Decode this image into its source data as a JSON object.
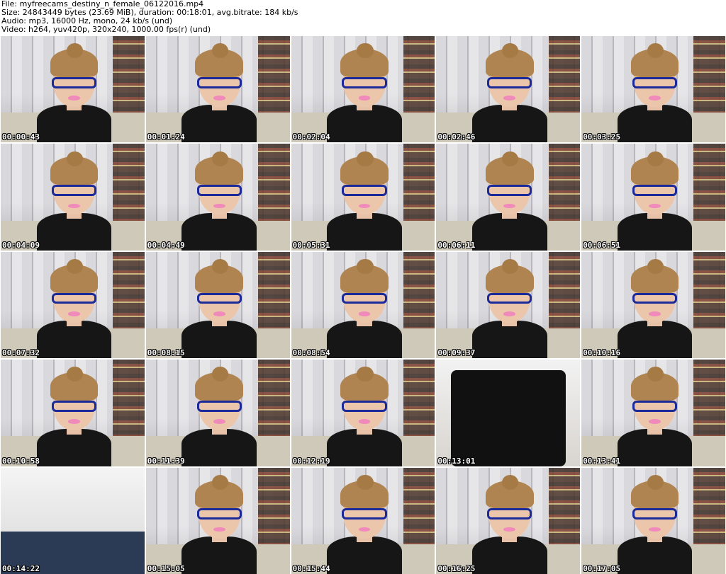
{
  "header": {
    "file": "File: myfreecams_destiny_n_female_06122016.mp4",
    "size": "Size: 24843449 bytes (23.69 MiB), duration: 00:18:01, avg.bitrate: 184 kb/s",
    "audio": "Audio: mp3, 16000 Hz, mono, 24 kb/s (und)",
    "video": "Video: h264, yuv420p, 320x240, 1000.00 fps(r) (und)"
  },
  "thumbnails": [
    {
      "time": "00:00:43"
    },
    {
      "time": "00:01:24"
    },
    {
      "time": "00:02:04"
    },
    {
      "time": "00:02:46"
    },
    {
      "time": "00:03:25"
    },
    {
      "time": "00:04:09"
    },
    {
      "time": "00:04:49"
    },
    {
      "time": "00:05:31"
    },
    {
      "time": "00:06:11"
    },
    {
      "time": "00:06:51"
    },
    {
      "time": "00:07:32"
    },
    {
      "time": "00:08:15"
    },
    {
      "time": "00:08:54"
    },
    {
      "time": "00:09:37"
    },
    {
      "time": "00:10:16"
    },
    {
      "time": "00:10:58"
    },
    {
      "time": "00:11:39"
    },
    {
      "time": "00:12:19"
    },
    {
      "time": "00:13:01"
    },
    {
      "time": "00:13:41"
    },
    {
      "time": "00:14:22"
    },
    {
      "time": "00:15:05"
    },
    {
      "time": "00:15:44"
    },
    {
      "time": "00:16:25"
    },
    {
      "time": "00:17:05"
    }
  ],
  "colors": {
    "timestamp": "#ffffff",
    "glasses": "#1b2a9a",
    "sofa": "#3a6fb5"
  }
}
